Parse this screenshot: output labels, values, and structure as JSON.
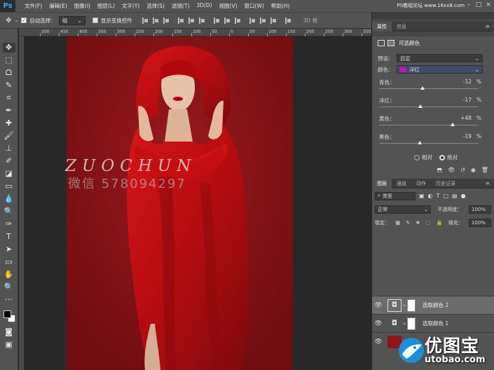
{
  "app": {
    "logo": "Ps"
  },
  "menu": [
    "文件(F)",
    "编辑(E)",
    "图像(I)",
    "图层(L)",
    "文字(Y)",
    "选择(S)",
    "滤镜(T)",
    "3D(D)",
    "视图(V)",
    "窗口(W)",
    "帮助(H)"
  ],
  "top_watermark": "PS教程论坛 www.16xx8.com",
  "options": {
    "auto_select_label": "自动选择：",
    "auto_select_checked": true,
    "auto_select_value": "组",
    "show_transform_label": "显示变换控件",
    "show_transform_checked": false,
    "mode_3d": "3D 模"
  },
  "ruler": [
    "500",
    "450",
    "400",
    "350",
    "300",
    "250",
    "200",
    "150",
    "100",
    "50",
    "0",
    "50",
    "100",
    "150",
    "200",
    "250",
    "300",
    "350"
  ],
  "canvas": {
    "watermark_latin": "ZUOCHUN",
    "watermark_cn": "微信 578094297",
    "photo_bg": "#8e1418",
    "cloak_color": "#c40e12"
  },
  "properties_panel": {
    "tabs": [
      "属性",
      "信息"
    ],
    "title": "可选颜色",
    "preset_label": "预设：",
    "preset_value": "自定",
    "color_label": "颜色：",
    "color_value": "洋红",
    "color_swatch": "#c018b8",
    "sliders": [
      {
        "label": "青色：",
        "value": "-12",
        "fraction": 0.44
      },
      {
        "label": "洋红：",
        "value": "-17",
        "fraction": 0.415
      },
      {
        "label": "黄色：",
        "value": "+48",
        "fraction": 0.74
      },
      {
        "label": "黑色：",
        "value": "-19",
        "fraction": 0.405
      }
    ],
    "pct": "%",
    "radio_relative": "相对",
    "radio_absolute": "绝对",
    "selected_mode": "绝对"
  },
  "layers_panel": {
    "tabs": [
      "图层",
      "通道",
      "动作",
      "历史记录"
    ],
    "filter_type": "类型",
    "blend_mode": "正常",
    "opacity_label": "不透明度：",
    "opacity_value": "100%",
    "lock_label": "锁定：",
    "fill_label": "填充：",
    "fill_value": "100%",
    "layers": [
      {
        "name": "选取颜色 2",
        "selected": true
      },
      {
        "name": "选取颜色 1",
        "selected": false
      },
      {
        "name": "",
        "selected": false
      }
    ]
  },
  "logo_overlay": {
    "name": "优图宝",
    "url": "utobao.com"
  }
}
